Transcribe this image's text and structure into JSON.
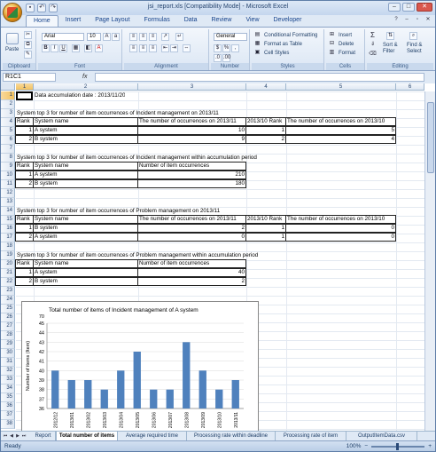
{
  "window": {
    "title": "jsi_report.xls [Compatibility Mode] - Microsoft Excel"
  },
  "ribbon": {
    "tabs": [
      "Home",
      "Insert",
      "Page Layout",
      "Formulas",
      "Data",
      "Review",
      "View",
      "Developer"
    ],
    "active_tab": "Home",
    "clipboard": {
      "paste": "Paste",
      "label": "Clipboard"
    },
    "font": {
      "name": "Arial",
      "size": "10",
      "label": "Font"
    },
    "alignment": {
      "label": "Alignment"
    },
    "number": {
      "format": "General",
      "label": "Number",
      "currency": "$",
      "percent": "%",
      "comma": ","
    },
    "styles": {
      "conditional": "Conditional Formatting",
      "format_table": "Format as Table",
      "cell_styles": "Cell Styles",
      "label": "Styles"
    },
    "cells": {
      "insert": "Insert",
      "delete": "Delete",
      "format": "Format",
      "label": "Cells"
    },
    "editing": {
      "sort": "Sort &",
      "filter": "Filter",
      "find": "Find &",
      "select": "Select",
      "label": "Editing"
    }
  },
  "formula_bar": {
    "name_box": "R1C1",
    "fx": "fx",
    "content": ""
  },
  "columns": [
    "1",
    "2",
    "3",
    "4",
    "5",
    "6"
  ],
  "rows": [
    "1",
    "2",
    "3",
    "4",
    "5",
    "6",
    "7",
    "8",
    "9",
    "10",
    "11",
    "12",
    "13",
    "14",
    "15",
    "16",
    "17",
    "18",
    "19",
    "20",
    "21",
    "22",
    "23",
    "24",
    "25",
    "26",
    "27",
    "28",
    "29",
    "30",
    "31",
    "32",
    "33",
    "34",
    "35",
    "36",
    "37",
    "38"
  ],
  "sheet": {
    "r1": "Data accumulation date : 2013/11/20",
    "r3": "System top 3 for number of item occurrences of Incident management on 2013/11",
    "t1": {
      "headers": [
        "Rank",
        "System name",
        "The number of occurrences on 2013/11",
        "2013/10 Rank",
        "The number of occurrences on 2013/10"
      ],
      "rows": [
        [
          "1",
          "A system",
          "10",
          "1",
          "5"
        ],
        [
          "2",
          "B system",
          "9",
          "2",
          "4"
        ]
      ]
    },
    "r8": "System top 3 for number of item occurrences of Incident management within accumulation period",
    "t2": {
      "headers": [
        "Rank",
        "System name",
        "Number of item occurrences"
      ],
      "rows": [
        [
          "1",
          "A system",
          "210"
        ],
        [
          "2",
          "B system",
          "180"
        ]
      ]
    },
    "r14": "System top 3 for number of item occurrences of Problem management on 2013/11",
    "t3": {
      "headers": [
        "Rank",
        "System name",
        "The number of occurrences on 2013/11",
        "2013/10 Rank",
        "The number of occurrences on 2013/10"
      ],
      "rows": [
        [
          "1",
          "B system",
          "2",
          "1",
          "0"
        ],
        [
          "2",
          "A system",
          "0",
          "1",
          "0"
        ]
      ]
    },
    "r19": "System top 3 for number of item occurrences of Problem management within accumulation period",
    "t4": {
      "headers": [
        "Rank",
        "System name",
        "Number of item occurrences"
      ],
      "rows": [
        [
          "1",
          "A system",
          "40"
        ],
        [
          "2",
          "B system",
          "2"
        ]
      ]
    }
  },
  "chart_data": {
    "type": "bar",
    "title": "Total number of items of Incident management of A system",
    "xlabel": "Accumulation unit (Monthly unit)",
    "ylabel": "Number of items (Item)",
    "categories": [
      "2012/12",
      "2013/01",
      "2013/02",
      "2013/03",
      "2013/04",
      "2013/05",
      "2013/06",
      "2013/07",
      "2013/08",
      "2013/09",
      "2013/10",
      "2013/11"
    ],
    "values": [
      40,
      39,
      39,
      38,
      40,
      42,
      38,
      38,
      43,
      40,
      38,
      39
    ],
    "ylim": [
      36,
      45
    ],
    "yticks": [
      "36",
      "37",
      "38",
      "39",
      "40",
      "41",
      "42",
      "43",
      "44",
      "45"
    ],
    "ylim_top_label": "70",
    "yticks_extra": [
      "60",
      "50"
    ],
    "color": "#4f81bd",
    "grid": true
  },
  "sheet_tabs": [
    "Report",
    "Total number of items",
    "Average required time",
    "Processing rate within deadline",
    "Processing rate of item",
    "OutputItemData.csv"
  ],
  "active_sheet": "Total number of items",
  "status": {
    "ready": "Ready",
    "zoom": "100%"
  }
}
